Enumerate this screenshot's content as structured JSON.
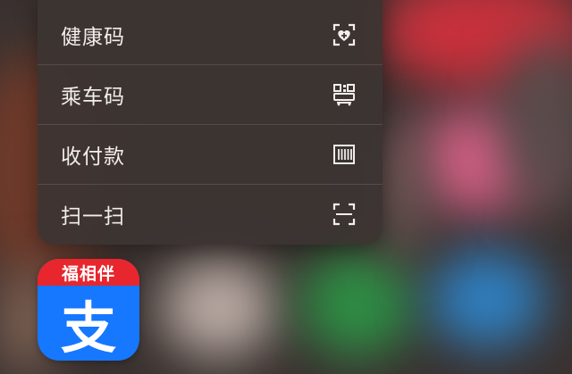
{
  "menu": {
    "items": [
      {
        "label": "健康码",
        "icon": "health-code-icon"
      },
      {
        "label": "乘车码",
        "icon": "transit-code-icon"
      },
      {
        "label": "收付款",
        "icon": "barcode-icon"
      },
      {
        "label": "扫一扫",
        "icon": "scan-icon"
      }
    ]
  },
  "app": {
    "badge": "福相伴",
    "glyph": "支",
    "brand_color": "#1677ff",
    "badge_color": "#e8262d"
  }
}
